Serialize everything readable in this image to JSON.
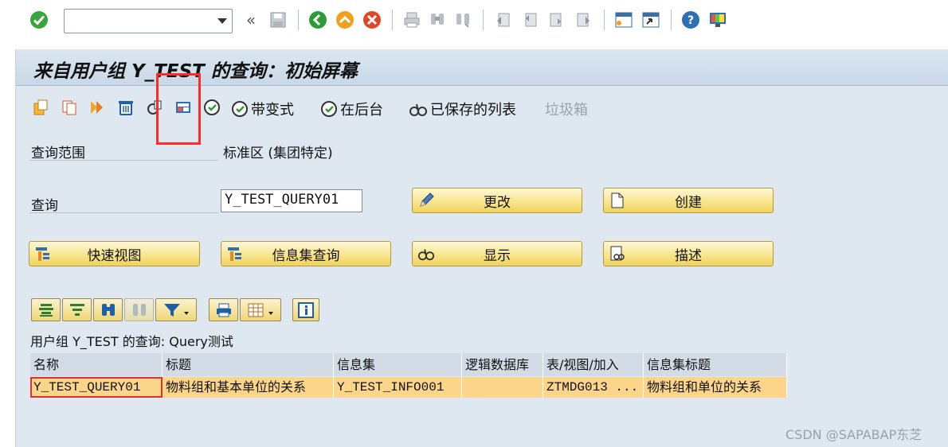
{
  "system_toolbar": {
    "command_field_value": "",
    "icons": [
      "enter-icon",
      "back-double-arrow-icon",
      "save-icon",
      "back-icon",
      "exit-icon",
      "cancel-icon",
      "print-icon",
      "find-icon",
      "find-next-icon",
      "first-page-icon",
      "prev-page-icon",
      "next-page-icon",
      "last-page-icon",
      "create-session-icon",
      "shortcut-icon",
      "help-icon",
      "layout-icon"
    ]
  },
  "window": {
    "title": "来自用户组 Y_TEST 的查询：初始屏幕"
  },
  "app_toolbar": {
    "with_variant": "带变式",
    "background": "在后台",
    "saved_lists": "已保存的列表",
    "trash": "垃圾箱"
  },
  "form": {
    "query_area_label": "查询范围",
    "query_area_value": "标准区 (集团特定)",
    "query_label": "查询",
    "query_value": "Y_TEST_QUERY01"
  },
  "buttons": {
    "change": "更改",
    "create": "创建",
    "quick_view": "快速视图",
    "infoset_query": "信息集查询",
    "display": "显示",
    "describe": "描述"
  },
  "grid": {
    "title": "用户组 Y_TEST 的查询: Query测试",
    "columns": [
      "名称",
      "标题",
      "信息集",
      "逻辑数据库",
      "表/视图/加入",
      "信息集标题"
    ],
    "rows": [
      [
        "Y_TEST_QUERY01",
        "物料组和基本单位的关系",
        "Y_TEST_INFO001",
        "",
        "ZTMDG013 ...",
        "物料组和单位的关系"
      ]
    ]
  },
  "colors": {
    "frame_bg": "#dfe8f1",
    "button_yellow": "#f8e58f",
    "row_highlight": "#fbd68a",
    "highlight_box": "#ff2a2a"
  },
  "watermark": "CSDN @SAPABAP东芝"
}
